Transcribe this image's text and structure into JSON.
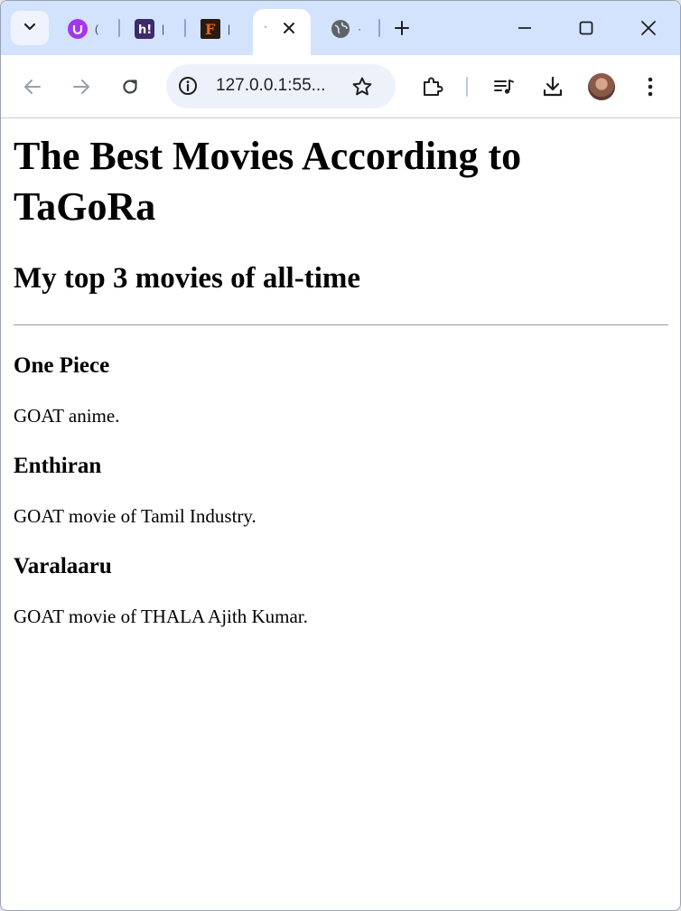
{
  "browser": {
    "tabs": [
      {
        "favicon": "udemy-u-icon",
        "label": "("
      },
      {
        "favicon": "h-bang-icon",
        "label": "|"
      },
      {
        "favicon": "f-letter-icon",
        "label": "|"
      },
      {
        "favicon": "globe-icon",
        "label": "·"
      }
    ],
    "active_tab": {
      "label": "·"
    },
    "address_bar": {
      "url": "127.0.0.1:55..."
    }
  },
  "page": {
    "title": "The Best Movies According to TaGoRa",
    "subtitle": "My top 3 movies of all-time",
    "movies": [
      {
        "name": "One Piece",
        "description": "GOAT anime."
      },
      {
        "name": "Enthiran",
        "description": "GOAT movie of Tamil Industry."
      },
      {
        "name": "Varalaaru",
        "description": "GOAT movie of THALA Ajith Kumar."
      }
    ]
  },
  "colors": {
    "tabstrip_bg": "#d3e3fd",
    "omnibox_bg": "#edf2fa",
    "accent_purple": "#9b3bf0"
  }
}
